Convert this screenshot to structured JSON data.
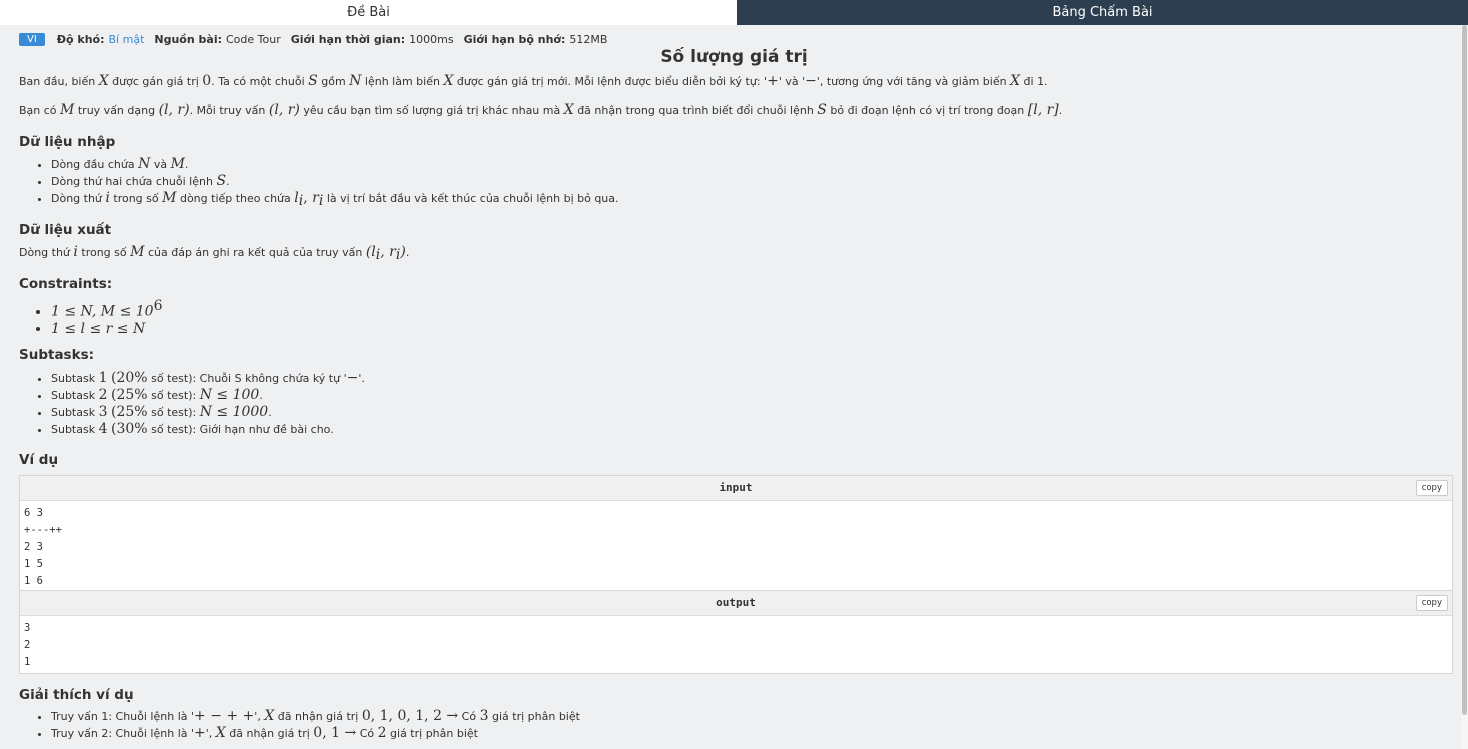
{
  "tabs": {
    "problem": "Đề Bài",
    "scoreboard": "Bảng Chấm Bài"
  },
  "meta": {
    "lang": "VI",
    "difficulty_label": "Độ khó:",
    "difficulty_value": "Bí mật",
    "source_label": "Nguồn bài:",
    "source_value": "Code Tour",
    "time_label": "Giới hạn thời gian:",
    "time_value": "1000ms",
    "memory_label": "Giới hạn bộ nhớ:",
    "memory_value": "512MB"
  },
  "title": "Số lượng giá trị",
  "statement": {
    "p1": [
      "Ban đầu, biến ",
      "X",
      " được gán giá trị ",
      "0",
      ". Ta có một chuỗi ",
      "S",
      " gồm ",
      "N",
      " lệnh làm biến ",
      "X",
      " được gán giá trị mới. Mỗi lệnh được biểu diễn bởi ký tự: '",
      "+",
      "' và '",
      "−",
      "', tương ứng với tăng và giảm biến ",
      "X",
      " đi 1."
    ],
    "p2": [
      "Bạn có ",
      "M",
      " truy vấn dạng ",
      "(l, r)",
      ". Mỗi truy vấn ",
      "(l, r)",
      " yêu cầu bạn tìm số lượng giá trị khác nhau mà ",
      "X",
      " đã nhận trong qua trình biết đổi chuỗi lệnh ",
      "S",
      " bỏ đi đoạn lệnh có vị trí trong đoạn ",
      "[l, r]",
      "."
    ]
  },
  "input_section": {
    "heading": "Dữ liệu nhập",
    "items": [
      [
        "Dòng đầu chứa ",
        "N",
        " và ",
        "M",
        "."
      ],
      [
        "Dòng thứ hai chứa chuỗi lệnh ",
        "S",
        "."
      ],
      [
        "Dòng thứ ",
        "i",
        " trong số ",
        "M",
        " dòng tiếp theo chứa ",
        "l",
        "i",
        ", ",
        "r",
        "i",
        " là vị trí bắt đầu và kết thúc của chuỗi lệnh bị bỏ qua."
      ]
    ]
  },
  "output_section": {
    "heading": "Dữ liệu xuất",
    "text": [
      "Dòng thứ ",
      "i",
      " trong số ",
      "M",
      " của đáp án ghi ra kết quả của truy vấn ",
      "(l",
      "i",
      ", r",
      "i",
      ")",
      "."
    ]
  },
  "constraints": {
    "heading": "Constraints:",
    "items": [
      [
        "1 ≤ N, M ≤ 10",
        "6"
      ],
      [
        "1 ≤ l ≤ r ≤ N"
      ]
    ]
  },
  "subtasks": {
    "heading": "Subtasks:",
    "items": [
      [
        "Subtask ",
        "1",
        " ",
        "(20%",
        " số test): Chuỗi S không chứa ký tự '",
        "−",
        "'."
      ],
      [
        "Subtask ",
        "2",
        " ",
        "(25%",
        " số test): ",
        "N ≤ 100",
        "."
      ],
      [
        "Subtask ",
        "3",
        " ",
        "(25%",
        " số test): ",
        "N ≤ 1000",
        "."
      ],
      [
        "Subtask ",
        "4",
        " ",
        "(30%",
        " số test): Giới hạn như đề bài cho."
      ]
    ]
  },
  "example": {
    "heading": "Ví dụ",
    "input_label": "input",
    "output_label": "output",
    "copy_label": "copy",
    "input_lines": [
      "6 3",
      "+---++",
      "2 3",
      "1 5",
      "1 6"
    ],
    "output_lines": [
      "3",
      "2",
      "1"
    ]
  },
  "explanation": {
    "heading": "Giải thích ví dụ",
    "items": [
      [
        "Truy vấn 1: Chuỗi lệnh là '",
        "+ − + +",
        "', ",
        "X",
        " đã nhận giá trị ",
        "0, 1, 0, 1, 2 →",
        " Có ",
        "3",
        " giá trị phân biệt"
      ],
      [
        "Truy vấn 2: Chuỗi lệnh là '",
        "+",
        "', ",
        "X",
        " đã nhận giá trị ",
        "0, 1 →",
        " Có ",
        "2",
        " giá trị phân biệt"
      ]
    ]
  }
}
